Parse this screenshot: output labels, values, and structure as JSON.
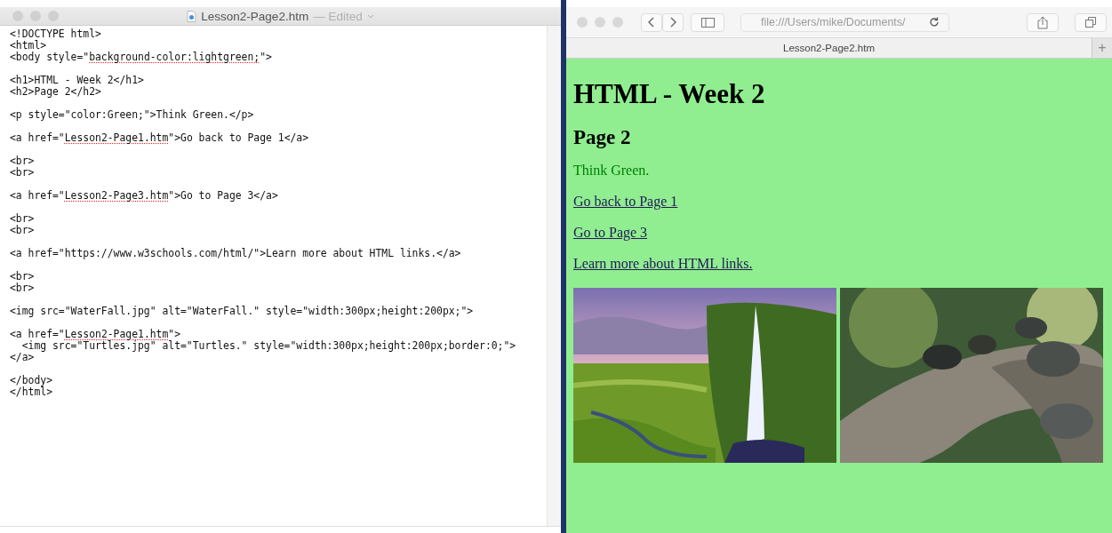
{
  "editor": {
    "title": "Lesson2-Page2.htm",
    "status": "— Edited",
    "blocks": [
      [
        [
          {
            "text": "<!DOCTYPE html>"
          }
        ],
        [
          {
            "text": "<html>"
          }
        ],
        [
          {
            "text": "<body style=\""
          },
          {
            "text": "background-color:lightgreen;",
            "misspelled": true
          },
          {
            "text": "\">"
          }
        ]
      ],
      [
        [
          {
            "text": "<h1>HTML - Week 2</h1>"
          }
        ],
        [
          {
            "text": "<h2>Page 2</h2>"
          }
        ]
      ],
      [
        [
          {
            "text": "<p style=\"color:Green;\">Think Green.</p>"
          }
        ]
      ],
      [
        [
          {
            "text": "<a href=\""
          },
          {
            "text": "Lesson2-Page1.htm",
            "misspelled": true
          },
          {
            "text": "\">Go back to Page 1</a>"
          }
        ]
      ],
      [
        [
          {
            "text": "<br>"
          }
        ],
        [
          {
            "text": "<br>"
          }
        ]
      ],
      [
        [
          {
            "text": "<a href=\""
          },
          {
            "text": "Lesson2-Page3.htm",
            "misspelled": true
          },
          {
            "text": "\">Go to Page 3</a>"
          }
        ]
      ],
      [
        [
          {
            "text": "<br>"
          }
        ],
        [
          {
            "text": "<br>"
          }
        ]
      ],
      [
        [
          {
            "text": "<a href=\"https://www.w3schools.com/html/\">Learn more about HTML links.</a>"
          }
        ]
      ],
      [
        [
          {
            "text": "<br>"
          }
        ],
        [
          {
            "text": "<br>"
          }
        ]
      ],
      [
        [
          {
            "text": "<img src=\"WaterFall.jpg\" alt=\"WaterFall.\" style=\"width:300px;height:200px;\">"
          }
        ]
      ],
      [
        [
          {
            "text": "<a href=\""
          },
          {
            "text": "Lesson2-Page1.htm",
            "misspelled": true
          },
          {
            "text": "\">"
          }
        ],
        [
          {
            "text": "  <img src=\"Turtles.jpg\" alt=\"Turtles.\" style=\"width:300px;height:200px;border:0;\">"
          }
        ],
        [
          {
            "text": "</a>"
          }
        ]
      ],
      [
        [
          {
            "text": "</body>"
          }
        ],
        [
          {
            "text": "</html>"
          }
        ]
      ]
    ]
  },
  "browser": {
    "address": "file:///Users/mike/Documents/",
    "tab": {
      "label": "Lesson2-Page2.htm"
    },
    "new_tab": "+",
    "page": {
      "heading": "HTML - Week 2",
      "subheading": "Page 2",
      "paragraph": "Think Green.",
      "links": [
        "Go back to Page 1",
        "Go to Page 3",
        "Learn more about HTML links."
      ]
    }
  }
}
